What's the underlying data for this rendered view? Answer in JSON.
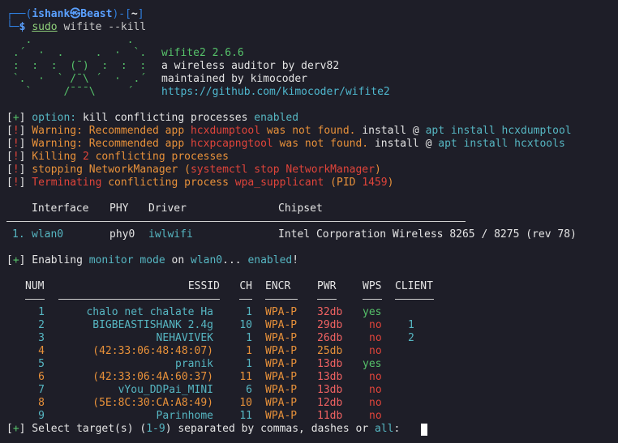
{
  "prompt": {
    "corner_top": "┌──(",
    "user": "ishank",
    "at_icon": "㉿",
    "host": "Beast",
    "close_paren": ")-[",
    "dir": "~",
    "close_bracket": "]",
    "corner_bottom": "└─",
    "dollar": "$ ",
    "sudo": "sudo",
    "cmd": " wifite --kill"
  },
  "banner": {
    "art": [
      "   .               .",
      " .´  ·  .     .  ·  `.",
      " :  :  :  (¯)  :  :  :",
      " `.  ·  ` /¯\\ ´  ·  .´",
      "   `     /¯¯¯\\     ´"
    ],
    "app_version": "wifite2 2.6.6",
    "tagline": "a wireless auditor by derv82",
    "maintainer": "maintained by kimocoder",
    "url": "https://github.com/kimocoder/wifite2"
  },
  "messages": {
    "line1": {
      "b1": "[",
      "mark": "+",
      "b2": "]",
      "k": " option: ",
      "opt": "kill conflicting processes",
      "val": " enabled"
    },
    "line2": {
      "b1": "[",
      "mark": "!",
      "b2": "]",
      "w": " Warning: Recommended app ",
      "app": "hcxdumptool",
      "mid": " was not found. ",
      "install": "install @ ",
      "apt": "apt install hcxdumptool"
    },
    "line3": {
      "b1": "[",
      "mark": "!",
      "b2": "]",
      "w": " Warning: Recommended app ",
      "app": "hcxpcapngtool",
      "mid": " was not found. ",
      "install": "install @ ",
      "apt": "apt install hcxtools"
    },
    "line4": {
      "b1": "[",
      "mark": "!",
      "b2": "]",
      "a": " Killing ",
      "n": "2",
      "b": " conflicting processes"
    },
    "line5": {
      "b1": "[",
      "mark": "!",
      "b2": "]",
      "a": " stopping NetworkManager (",
      "cmd": "systemctl stop NetworkManager",
      "b": ")"
    },
    "line6": {
      "b1": "[",
      "mark": "!",
      "b2": "]",
      "a": " Terminating",
      "b": " conflicting process ",
      "proc": "wpa_supplicant",
      "c": " (PID ",
      "pid": "1459",
      "d": ")"
    }
  },
  "iface_table": {
    "headers": {
      "interface": "Interface",
      "phy": "PHY",
      "driver": "Driver",
      "chipset": "Chipset"
    },
    "row": {
      "idx": "1.",
      "interface": "wlan0",
      "phy": "phy0",
      "driver": "iwlwifi",
      "chipset": "Intel Corporation Wireless 8265 / 8275 (rev 78)"
    }
  },
  "monitor": {
    "b1": "[",
    "mark": "+",
    "b2": "]",
    "a": " Enabling ",
    "mode": "monitor mode",
    "on": " on ",
    "iface": "wlan0",
    "dots": "... ",
    "enabled": "enabled",
    "bang": "!"
  },
  "scan": {
    "headers": {
      "num": "NUM",
      "essid": "ESSID",
      "ch": "CH",
      "encr": "ENCR",
      "pwr": "PWR",
      "wps": "WPS",
      "client": "CLIENT"
    },
    "rows": [
      {
        "num": "1",
        "essid": "chalo net chalate Ha",
        "ch": "1",
        "encr": "WPA-P",
        "pwr": "32db",
        "wps": "yes",
        "client": ""
      },
      {
        "num": "2",
        "essid": "BIGBEASTISHANK 2.4g",
        "ch": "10",
        "encr": "WPA-P",
        "pwr": "29db",
        "wps": "no",
        "client": "1"
      },
      {
        "num": "3",
        "essid": "NEHAVIVEK",
        "ch": "1",
        "encr": "WPA-P",
        "pwr": "26db",
        "wps": "no",
        "client": "2"
      },
      {
        "num": "4",
        "essid": "(42:33:06:48:48:07)",
        "ch": "1",
        "encr": "WPA-P",
        "pwr": "25db",
        "wps": "no",
        "client": ""
      },
      {
        "num": "5",
        "essid": "pranik",
        "ch": "1",
        "encr": "WPA-P",
        "pwr": "13db",
        "wps": "yes",
        "client": ""
      },
      {
        "num": "6",
        "essid": "(42:33:06:4A:60:37)",
        "ch": "11",
        "encr": "WPA-P",
        "pwr": "13db",
        "wps": "no",
        "client": ""
      },
      {
        "num": "7",
        "essid": "vYou_DDPai_MINI",
        "ch": "6",
        "encr": "WPA-P",
        "pwr": "13db",
        "wps": "no",
        "client": ""
      },
      {
        "num": "8",
        "essid": "(5E:8C:30:CA:A8:49)",
        "ch": "10",
        "encr": "WPA-P",
        "pwr": "12db",
        "wps": "no",
        "client": ""
      },
      {
        "num": "9",
        "essid": "Parinhome",
        "ch": "11",
        "encr": "WPA-P",
        "pwr": "11db",
        "wps": "no",
        "client": ""
      }
    ]
  },
  "select": {
    "b1": "[",
    "mark": "+",
    "b2": "]",
    "a": " Select target(s) (",
    "range": "1-9",
    "b": ") separated by commas, dashes or ",
    "all": "all",
    "c": ": "
  }
}
